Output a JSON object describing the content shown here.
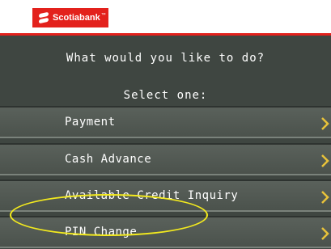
{
  "brand": {
    "name": "Scotiabank",
    "trademark": "™",
    "color": "#e3211c"
  },
  "screen": {
    "prompt": "What would you like to do?",
    "subprompt": "Select one:",
    "options": [
      {
        "label": "Payment"
      },
      {
        "label": "Cash Advance"
      },
      {
        "label": "Available Credit Inquiry"
      },
      {
        "label": "PIN Change",
        "highlighted": true
      }
    ],
    "highlight_color": "#f3ea1e",
    "chevron_color": "#e8c23a"
  }
}
